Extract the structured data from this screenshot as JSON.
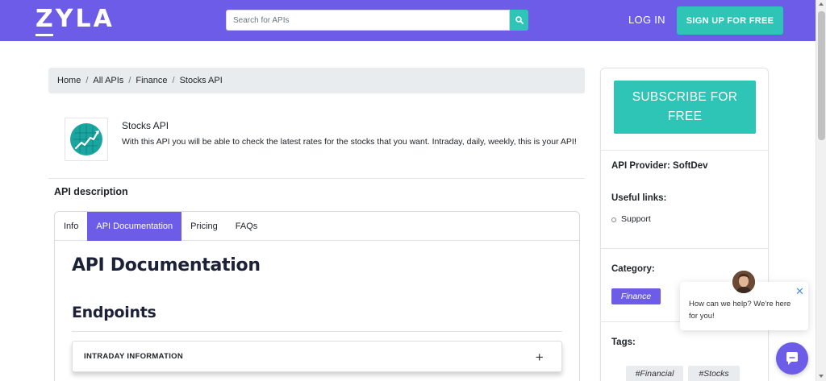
{
  "header": {
    "logo_text": "ZYLA",
    "search_placeholder": "Search for APIs",
    "login_label": "LOG IN",
    "signup_label": "SIGN UP FOR FREE"
  },
  "breadcrumb": [
    {
      "label": "Home"
    },
    {
      "label": "All APIs"
    },
    {
      "label": "Finance"
    },
    {
      "label": "Stocks API"
    }
  ],
  "api": {
    "name": "Stocks API",
    "description": "With this API you will be able to check the latest rates for the stocks that you want. Intraday, daily, weekly, this is your API!"
  },
  "section_title": "API description",
  "tabs": [
    {
      "label": "Info",
      "active": false
    },
    {
      "label": "API Documentation",
      "active": true
    },
    {
      "label": "Pricing",
      "active": false
    },
    {
      "label": "FAQs",
      "active": false
    }
  ],
  "doc": {
    "title": "API Documentation",
    "endpoints_title": "Endpoints",
    "endpoint_item": "INTRADAY INFORMATION",
    "expand_symbol": "+"
  },
  "sidebar": {
    "subscribe_label": "SUBSCRIBE FOR FREE",
    "provider": "API Provider: SoftDev",
    "useful_links_title": "Useful links:",
    "links": [
      "Support"
    ],
    "category_title": "Category:",
    "category": "Finance",
    "tags_title": "Tags:",
    "tags": [
      "#Financial",
      "#Stocks"
    ]
  },
  "chat": {
    "message": "How can we help? We're here for you!",
    "close_symbol": "✕"
  },
  "colors": {
    "brand": "#6c5ce7",
    "accent": "#2ec4b6"
  }
}
